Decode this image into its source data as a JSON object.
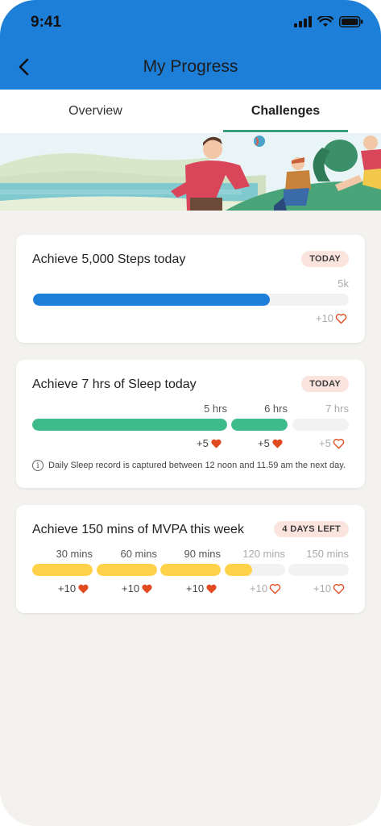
{
  "status": {
    "time": "9:41"
  },
  "header": {
    "title": "My Progress"
  },
  "tabs": [
    {
      "label": "Overview",
      "active": false
    },
    {
      "label": "Challenges",
      "active": true
    }
  ],
  "colors": {
    "header_bg": "#1e7fd9",
    "tab_indicator": "#3a9e7c",
    "steps_bar": "#1e7fd9",
    "sleep_bar": "#3dbb8a",
    "mvpa_bar": "#ffd24a",
    "heart": "#e04a1e",
    "badge_bg": "#fbe4dd"
  },
  "challenges": [
    {
      "title": "Achieve 5,000 Steps today",
      "badge": "TODAY",
      "goal_label": "5k",
      "progress": 0.75,
      "reward": "+10",
      "reward_earned": false
    },
    {
      "title": "Achieve 7 hrs of Sleep today",
      "badge": "TODAY",
      "segments": [
        {
          "label": "5 hrs",
          "fill": 1.0,
          "reward": "+5",
          "earned": true
        },
        {
          "label": "6 hrs",
          "fill": 1.0,
          "reward": "+5",
          "earned": true
        },
        {
          "label": "7 hrs",
          "fill": 0.0,
          "reward": "+5",
          "earned": false
        }
      ],
      "note": "Daily Sleep record is captured between 12 noon and 11.59 am the next day."
    },
    {
      "title": "Achieve 150 mins of MVPA this week",
      "badge": "4 DAYS LEFT",
      "segments": [
        {
          "label": "30 mins",
          "fill": 1.0,
          "reward": "+10",
          "earned": true
        },
        {
          "label": "60 mins",
          "fill": 1.0,
          "reward": "+10",
          "earned": true
        },
        {
          "label": "90 mins",
          "fill": 1.0,
          "reward": "+10",
          "earned": true
        },
        {
          "label": "120 mins",
          "fill": 0.45,
          "reward": "+10",
          "earned": false
        },
        {
          "label": "150 mins",
          "fill": 0.0,
          "reward": "+10",
          "earned": false
        }
      ]
    }
  ]
}
